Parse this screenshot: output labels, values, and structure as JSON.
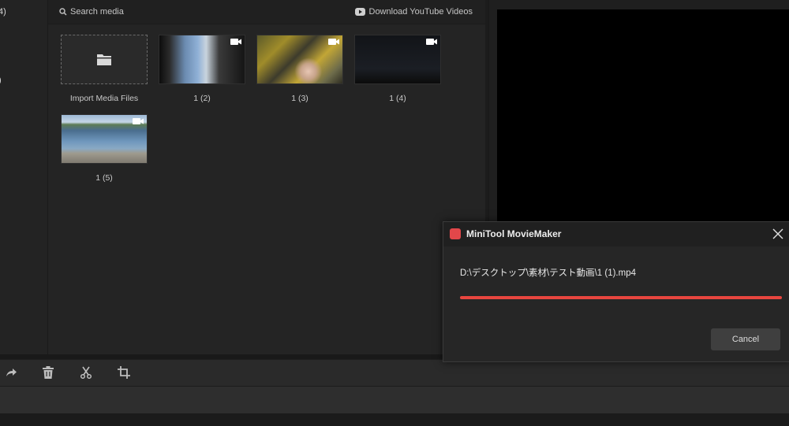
{
  "sidebar": {
    "items": [
      {
        "label": "4)"
      },
      {
        "label": ")"
      }
    ]
  },
  "media": {
    "search_placeholder": "Search media",
    "youtube_label": "Download YouTube Videos",
    "import_label": "Import Media Files",
    "clips": [
      {
        "name": "1 (2)"
      },
      {
        "name": "1 (3)"
      },
      {
        "name": "1 (4)"
      },
      {
        "name": "1 (5)"
      }
    ]
  },
  "toolbar": {
    "icons": [
      "redo-icon",
      "delete-icon",
      "split-icon",
      "crop-icon"
    ]
  },
  "dialog": {
    "title": "MiniTool MovieMaker",
    "file_path": "D:\\デスクトップ\\素材\\テスト動画\\1 (1).mp4",
    "progress": 1.0,
    "cancel_label": "Cancel"
  },
  "colors": {
    "accent": "#e8463f",
    "background": "#191919",
    "panel": "#242424"
  }
}
